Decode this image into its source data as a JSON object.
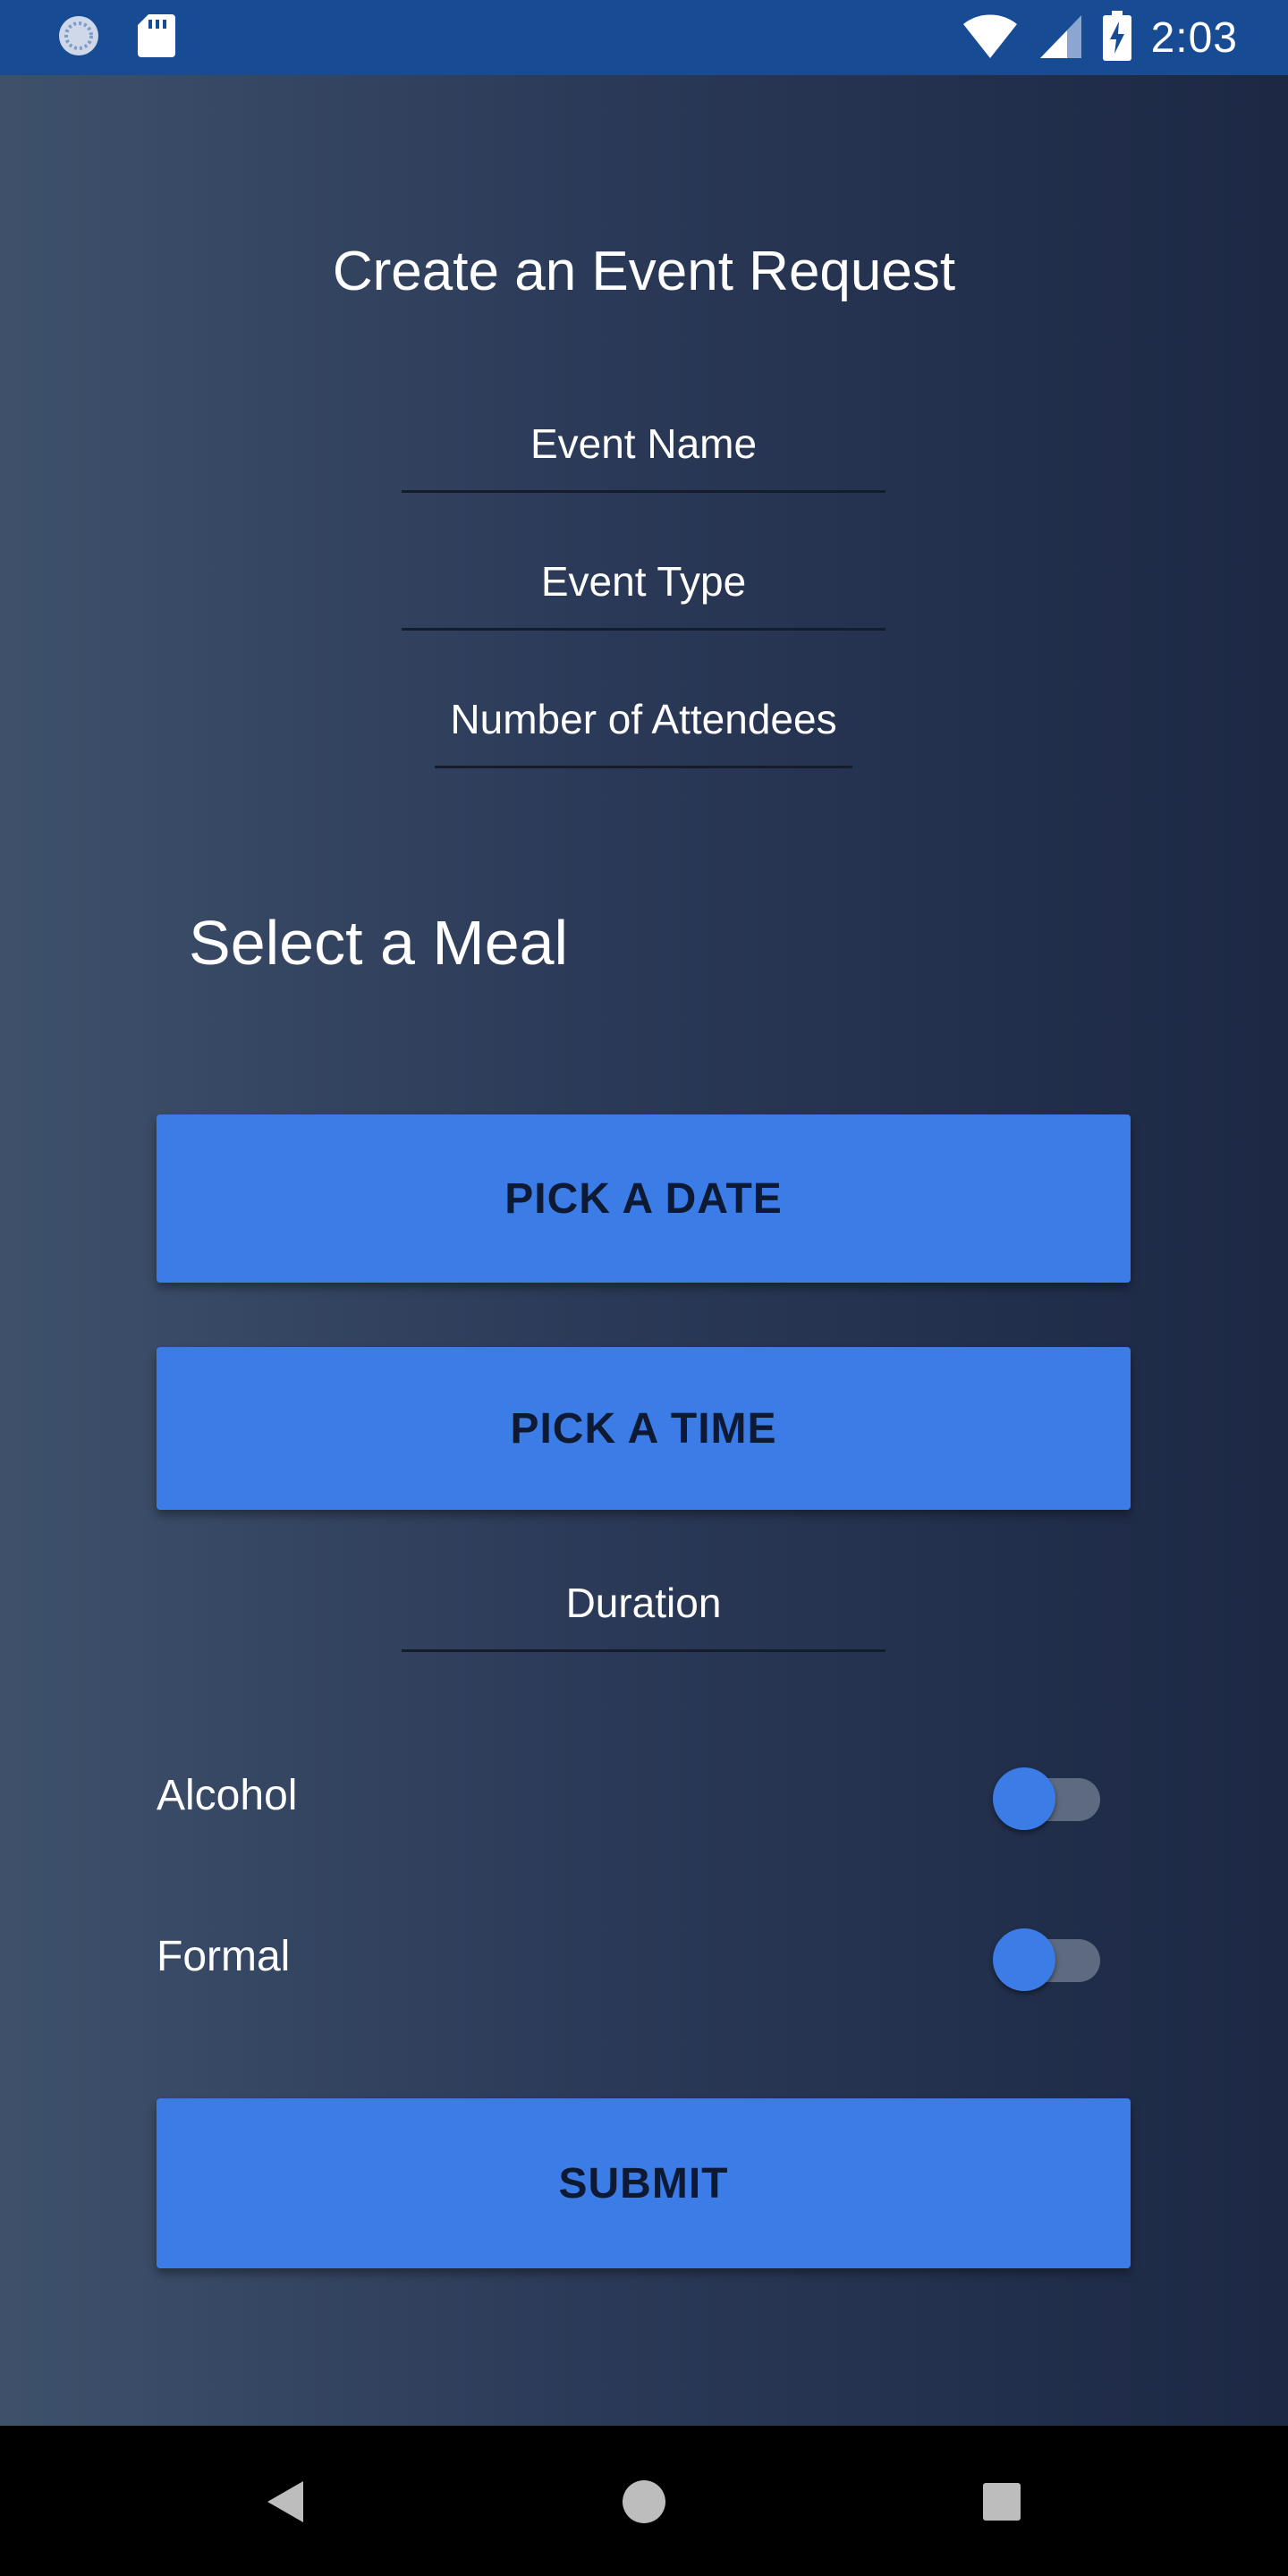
{
  "status_bar": {
    "time": "2:03",
    "left_icons": [
      "sync-icon",
      "sd-card-icon"
    ],
    "right_icons": [
      "wifi-icon",
      "cellular-signal-icon",
      "battery-charging-icon"
    ]
  },
  "page": {
    "title": "Create an Event Request"
  },
  "fields": {
    "event_name": {
      "placeholder": "Event Name",
      "value": ""
    },
    "event_type": {
      "placeholder": "Event Type",
      "value": ""
    },
    "attendees": {
      "placeholder": "Number of Attendees",
      "value": ""
    },
    "duration": {
      "placeholder": "Duration",
      "value": ""
    }
  },
  "meal": {
    "label": "Select a Meal"
  },
  "buttons": {
    "pick_date": "PICK A DATE",
    "pick_time": "PICK A TIME",
    "submit": "SUBMIT"
  },
  "toggles": {
    "alcohol": {
      "label": "Alcohol",
      "on": false
    },
    "formal": {
      "label": "Formal",
      "on": false
    }
  },
  "nav": {
    "icons": [
      "back-icon",
      "home-icon",
      "recents-icon"
    ]
  },
  "colors": {
    "accent": "#3b7ce6",
    "status_bar": "#174b94",
    "background_dark": "#1c2844",
    "background_light": "#3e516b"
  }
}
